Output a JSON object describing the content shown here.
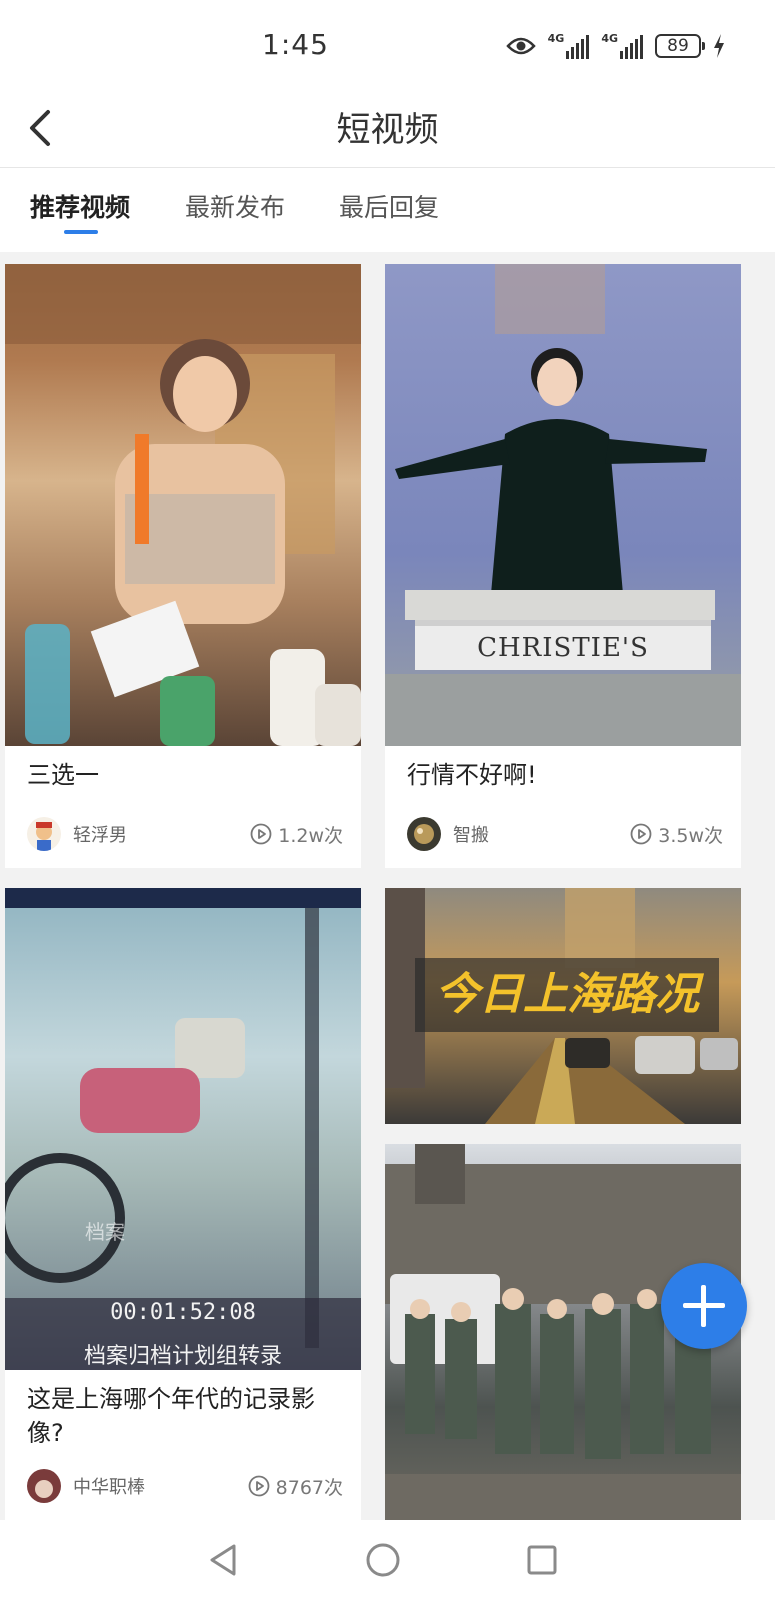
{
  "status_bar": {
    "time": "1:45",
    "network_1": "4G",
    "network_2": "4G",
    "battery": "89",
    "icons": [
      "eye-icon",
      "signal-icon",
      "signal-icon",
      "battery-icon",
      "charging-icon"
    ]
  },
  "header": {
    "title": "短视频",
    "back_icon": "chevron-left-icon"
  },
  "tabs": [
    {
      "label": "推荐视频",
      "active": true
    },
    {
      "label": "最新发布",
      "active": false
    },
    {
      "label": "最后回复",
      "active": false
    }
  ],
  "feed": {
    "items": [
      {
        "title": "三选一",
        "author": "轻浮男",
        "views": "1.2w次"
      },
      {
        "title": "行情不好啊!",
        "author": "智搬",
        "views": "3.5w次",
        "thumb_sign": "CHRISTIE'S"
      },
      {
        "title": "这是上海哪个年代的记录影像?",
        "author": "中华职棒",
        "views": "8767次",
        "thumb_timecode": "00:01:52:08",
        "thumb_caption": "档案归档计划组转录",
        "thumb_watermark": "档案"
      },
      {
        "thumb_banner": "今日上海路况"
      },
      {}
    ]
  },
  "colors": {
    "accent": "#2d7ee8",
    "background": "#f2f2f2"
  },
  "fab": {
    "icon": "plus-icon"
  },
  "nav_bar": {
    "icons": [
      "back-triangle-icon",
      "home-circle-icon",
      "recents-square-icon"
    ]
  }
}
